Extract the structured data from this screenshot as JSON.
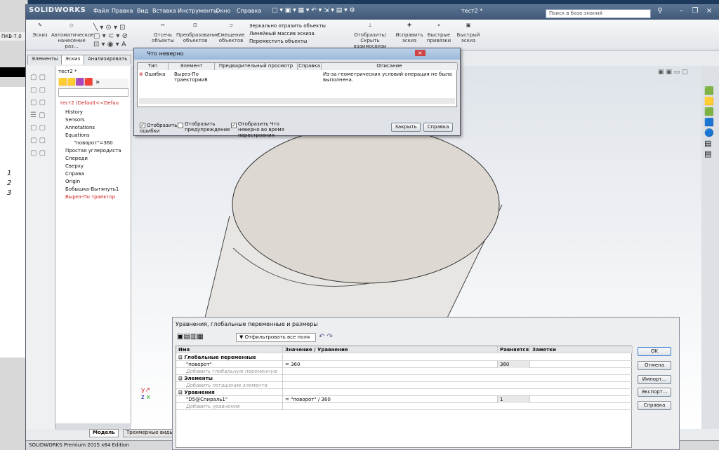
{
  "app": {
    "brand": "SOLIDWORKS",
    "window_title": "тест2 *",
    "search_placeholder": "Поиск в базе знаний",
    "menus": [
      "Файл",
      "Правка",
      "Вид",
      "Вставка",
      "Инструменты",
      "Окно",
      "Справка"
    ],
    "ribbon": [
      {
        "label": "Эскиз"
      },
      {
        "label": "Автоматическое нанесение раз..."
      },
      {
        "label": "Отсечь объекты"
      },
      {
        "label": "Преобразование объектов"
      },
      {
        "label": "Смещение объектов"
      },
      {
        "label": "Зеркально отразить объекты"
      },
      {
        "label": "Линейный массив эскиза"
      },
      {
        "label": "Переместить объекты"
      },
      {
        "label": "Отобразить/Скрыть взаимосвязи"
      },
      {
        "label": "Исправить эскиз"
      },
      {
        "label": "Быстрые привязки"
      },
      {
        "label": "Быстрый эскиз"
      }
    ],
    "tabs": [
      "Элементы",
      "Эскиз",
      "Анализировать"
    ],
    "status": "SOLIDWORKS Premium 2015 x64 Edition",
    "bottom_tabs": [
      "Модель",
      "Трехмерные виды"
    ]
  },
  "left_edge": {
    "label": "ПКВ-7,0"
  },
  "left_numbers": [
    "1",
    "2",
    "3"
  ],
  "tree": {
    "doc": "тест2 *",
    "root": "тест2 (Default<<Defau",
    "items": [
      "History",
      "Sensors",
      "Annotations",
      "Equations",
      "\"поворот\"=360",
      "Простая углеродиста",
      "Спереди",
      "Сверху",
      "Справа",
      "Origin",
      "Бобышка-Вытянуть1",
      "Вырез-По траектор"
    ]
  },
  "error_dialog": {
    "title": "Что неверно",
    "columns": [
      "Тип",
      "Элемент",
      "Предварительный просмотр",
      "Справка",
      "Описание"
    ],
    "row": {
      "type": "Ошибка",
      "element": "Вырез-По траектории8",
      "description": "Из-за геометрических условий операция не была выполнена."
    },
    "opt1": "Отобразить ошибки",
    "opt2": "Отобразить предупреждение",
    "opt3": "Отобразить Что неверно во время перестроения",
    "close": "Закрыть",
    "help": "Справка"
  },
  "eq_dialog": {
    "title": "Уравнения, глобальные переменные и размеры",
    "filter": "Отфильтровать все поля",
    "columns": [
      "Имя",
      "Значение / Уравнение",
      "Равняется",
      "Заметки"
    ],
    "sections": [
      {
        "name": "Глобальные переменные",
        "row_name": "\"поворот\"",
        "row_value": "= 360",
        "row_result": "360",
        "add": "Добавить глобальную переменную"
      },
      {
        "name": "Элементы",
        "add": "Добавить погашение элемента"
      },
      {
        "name": "Уравнения",
        "row_name": "\"D5@Спираль1\"",
        "row_value": "= \"поворот\" / 360",
        "row_result": "1",
        "add": "Добавить уравнение"
      }
    ],
    "buttons": [
      "OK",
      "Отмена",
      "Импорт...",
      "Экспорт...",
      "Справка"
    ]
  },
  "colors": {
    "accent": "#3f5877",
    "error": "#cc2222",
    "cylinder": "#ddd8d2"
  }
}
